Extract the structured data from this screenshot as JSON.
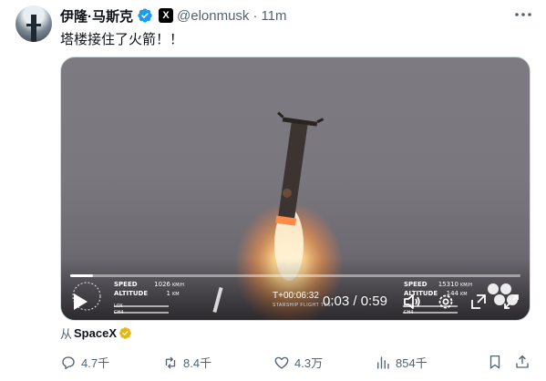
{
  "author": {
    "display_name": "伊隆·马斯克",
    "handle": "@elonmusk",
    "separator": "·",
    "time": "11m",
    "badge_letter": "X",
    "verified_color": "#1d9bf0"
  },
  "tweet": {
    "text": "塔楼接住了火箭！！"
  },
  "video": {
    "current_time": "0:03",
    "duration": "0:59",
    "time_separator": "/",
    "progress_fraction": 0.05,
    "telemetry_left": {
      "speed_label": "SPEED",
      "speed_value": "1026",
      "speed_unit": "KM/H",
      "altitude_label": "ALTITUDE",
      "altitude_value": "1",
      "altitude_unit": "KM",
      "row3": "LOX",
      "row4": "CH4"
    },
    "telemetry_right": {
      "speed_label": "SPEED",
      "speed_value": "15310",
      "speed_unit": "KM/H",
      "altitude_label": "ALTITUDE",
      "altitude_value": "144",
      "altitude_unit": "KM",
      "row3": "LOX",
      "row4": "CH4"
    },
    "mission_clock": "T+00:06:32",
    "mission_subtitle": "STARSHIP FLIGHT TEST"
  },
  "source": {
    "prefix": "从",
    "name": "SpaceX",
    "badge_color": "#e2b719"
  },
  "actions": {
    "replies": "4.7千",
    "reposts": "8.4千",
    "likes": "4.3万",
    "views": "854千"
  },
  "icons": {
    "verified": "verified-check-icon",
    "more": "more-dots-icon",
    "play": "play-icon",
    "volume": "volume-icon",
    "settings": "gear-icon",
    "pip": "picture-in-picture-icon",
    "fullscreen": "fullscreen-icon",
    "reply": "reply-icon",
    "repost": "repost-icon",
    "like": "heart-icon",
    "views": "views-bar-icon",
    "bookmark": "bookmark-icon",
    "share": "share-icon"
  }
}
